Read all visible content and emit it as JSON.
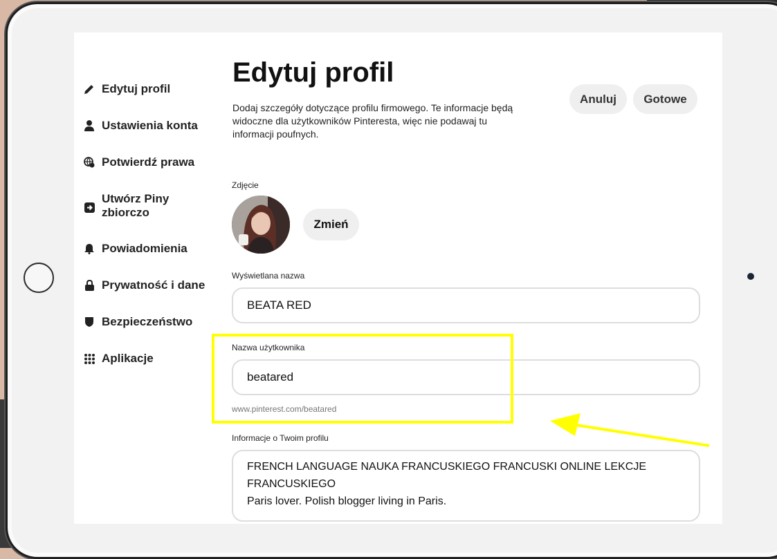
{
  "sidebar": {
    "items": [
      {
        "label": "Edytuj profil",
        "icon": "pencil-icon"
      },
      {
        "label": "Ustawienia konta",
        "icon": "person-icon"
      },
      {
        "label": "Potwierdź prawa",
        "icon": "globe-icon"
      },
      {
        "label": "Utwórz Piny zbiorczo",
        "icon": "import-icon"
      },
      {
        "label": "Powiadomienia",
        "icon": "bell-icon"
      },
      {
        "label": "Prywatność i dane",
        "icon": "lock-icon"
      },
      {
        "label": "Bezpieczeństwo",
        "icon": "shield-icon"
      },
      {
        "label": "Aplikacje",
        "icon": "apps-grid-icon"
      }
    ]
  },
  "header": {
    "title": "Edytuj profil",
    "description": "Dodaj szczegóły dotyczące profilu firmowego. Te informacje będą widoczne dla użytkowników Pinteresta, więc nie podawaj tu informacji poufnych.",
    "cancel_label": "Anuluj",
    "done_label": "Gotowe"
  },
  "photo": {
    "label": "Zdjęcie",
    "change_label": "Zmień"
  },
  "form": {
    "display_name_label": "Wyświetlana nazwa",
    "display_name_value": "BEATA RED",
    "username_label": "Nazwa użytkownika",
    "username_value": "beatared",
    "username_url": "www.pinterest.com/beatared",
    "about_label": "Informacje o Twoim profilu",
    "about_line1": "FRENCH LANGUAGE NAUKA FRANCUSKIEGO FRANCUSKI ONLINE LEKCJE",
    "about_line2": "FRANCUSKIEGO",
    "about_line3": "Paris lover. Polish blogger living in Paris."
  },
  "colors": {
    "highlight": "#ffff00",
    "button_bg": "#efefef"
  }
}
